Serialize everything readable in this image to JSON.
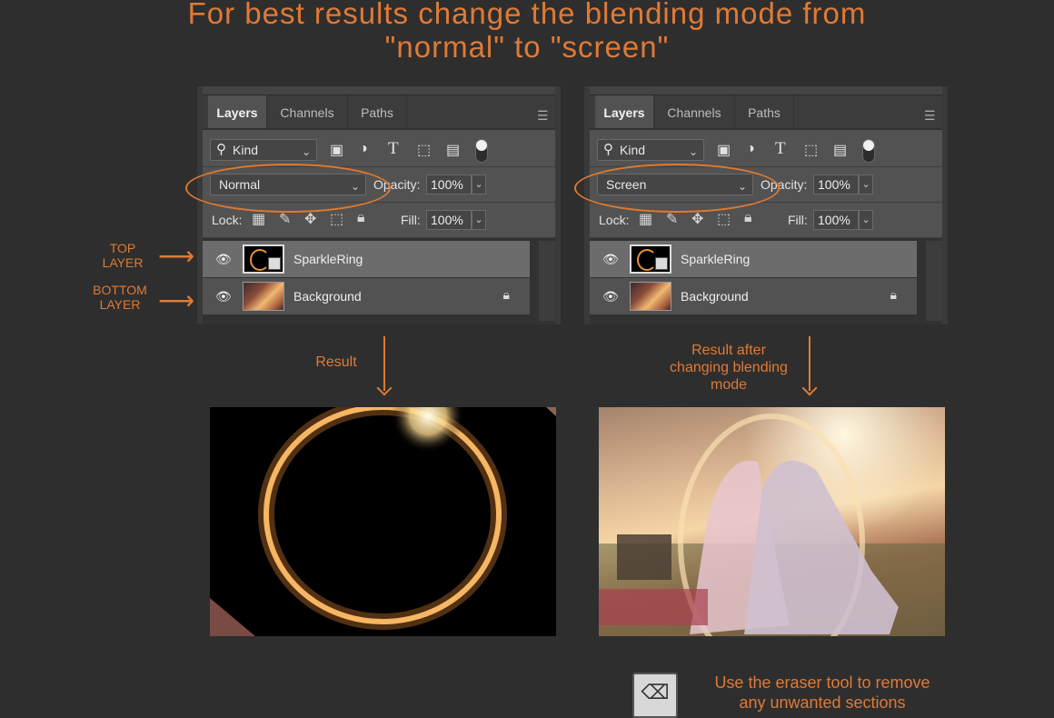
{
  "heading": {
    "line1": "For best results change the blending mode from",
    "line2": "\"normal\" to \"screen\""
  },
  "panels": [
    {
      "tabs": [
        "Layers",
        "Channels",
        "Paths"
      ],
      "filter_kind": "Kind",
      "blend_mode": "Normal",
      "opacity_label": "Opacity:",
      "opacity_value": "100%",
      "lock_label": "Lock:",
      "fill_label": "Fill:",
      "fill_value": "100%",
      "layers": [
        {
          "name": "SparkleRing",
          "icon": "smart-object-thumbnail"
        },
        {
          "name": "Background",
          "icon": "photo-thumbnail",
          "locked": true
        }
      ]
    },
    {
      "tabs": [
        "Layers",
        "Channels",
        "Paths"
      ],
      "filter_kind": "Kind",
      "blend_mode": "Screen",
      "opacity_label": "Opacity:",
      "opacity_value": "100%",
      "lock_label": "Lock:",
      "fill_label": "Fill:",
      "fill_value": "100%",
      "layers": [
        {
          "name": "SparkleRing",
          "icon": "smart-object-thumbnail"
        },
        {
          "name": "Background",
          "icon": "photo-thumbnail",
          "locked": true
        }
      ]
    }
  ],
  "annotations": {
    "top_layer": "TOP\nLAYER",
    "bottom_layer": "BOTTOM\nLAYER",
    "result": "Result",
    "result_after": "Result after\nchanging blending\nmode",
    "eraser_hint": "Use the eraser tool to remove\nany unwanted sections"
  },
  "colors": {
    "accent": "#e07a36",
    "background": "#2e2e2e",
    "panel": "#525252"
  }
}
